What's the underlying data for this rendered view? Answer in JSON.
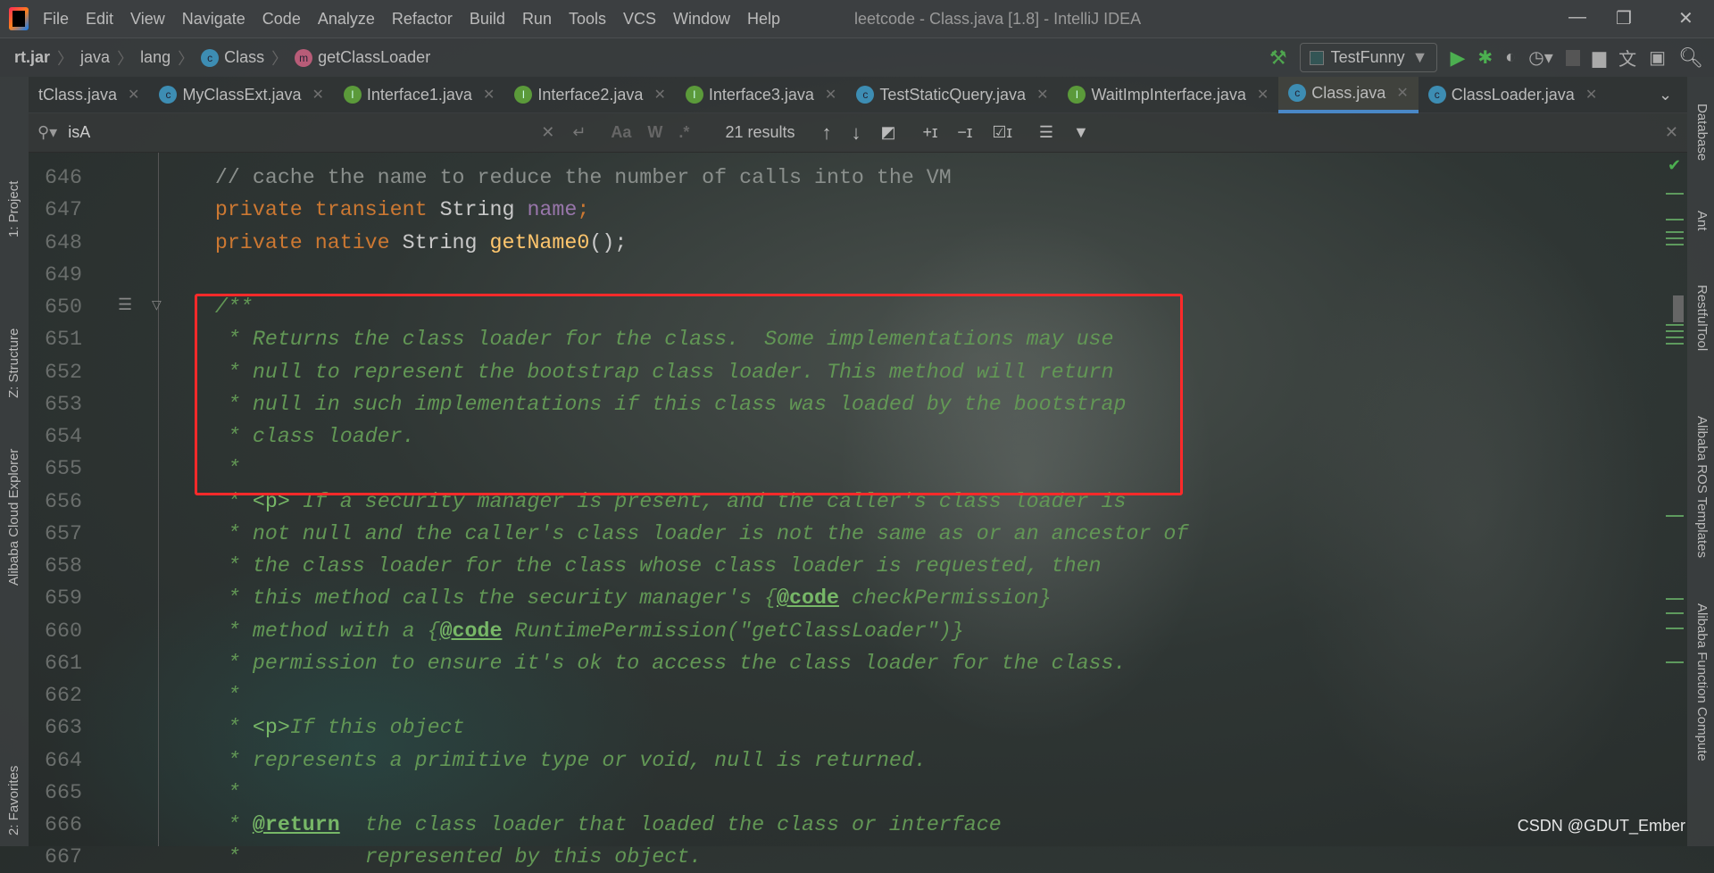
{
  "menu": [
    "File",
    "Edit",
    "View",
    "Navigate",
    "Code",
    "Analyze",
    "Refactor",
    "Build",
    "Run",
    "Tools",
    "VCS",
    "Window",
    "Help"
  ],
  "window_title": "leetcode - Class.java [1.8] - IntelliJ IDEA",
  "breadcrumb": [
    {
      "label": "rt.jar",
      "icon": ""
    },
    {
      "label": "java",
      "icon": ""
    },
    {
      "label": "lang",
      "icon": ""
    },
    {
      "label": "Class",
      "icon": "class-icon"
    },
    {
      "label": "getClassLoader",
      "icon": "method-icon"
    }
  ],
  "run_config": "TestFunny",
  "tabs": [
    {
      "label": "tClass.java",
      "icon": "",
      "active": false
    },
    {
      "label": "MyClassExt.java",
      "icon": "c",
      "active": false
    },
    {
      "label": "Interface1.java",
      "icon": "i",
      "active": false
    },
    {
      "label": "Interface2.java",
      "icon": "i",
      "active": false
    },
    {
      "label": "Interface3.java",
      "icon": "i",
      "active": false
    },
    {
      "label": "TestStaticQuery.java",
      "icon": "c",
      "active": false
    },
    {
      "label": "WaitImpInterface.java",
      "icon": "i",
      "active": false
    },
    {
      "label": "Class.java",
      "icon": "c",
      "active": true
    },
    {
      "label": "ClassLoader.java",
      "icon": "c",
      "active": false
    }
  ],
  "search": {
    "query": "isA",
    "match_case": "Aa",
    "words": "W",
    "regex": ".*",
    "results": "21 results"
  },
  "left_tools": [
    "1: Project",
    "Z: Structure",
    "Alibaba Cloud Explorer",
    "2: Favorites"
  ],
  "right_tools": [
    "Database",
    "Ant",
    "RestfulTool",
    "Alibaba ROS Templates",
    "Alibaba Function Compute"
  ],
  "code_lines": [
    {
      "n": "646",
      "s": [
        [
          "    ",
          ""
        ],
        [
          "// cache the name to reduce the number of calls into the VM",
          "cm"
        ]
      ]
    },
    {
      "n": "647",
      "s": [
        [
          "    ",
          ""
        ],
        [
          "private transient ",
          "kw"
        ],
        [
          "String ",
          "ty"
        ],
        [
          "name",
          "fd"
        ],
        [
          ";",
          "kw"
        ]
      ]
    },
    {
      "n": "648",
      "s": [
        [
          "    ",
          ""
        ],
        [
          "private native ",
          "kw"
        ],
        [
          "String ",
          "ty"
        ],
        [
          "getName0",
          "fn"
        ],
        [
          "();",
          "ty"
        ]
      ]
    },
    {
      "n": "649",
      "s": []
    },
    {
      "n": "650",
      "s": [
        [
          "    ",
          ""
        ],
        [
          "/**",
          "doc"
        ]
      ]
    },
    {
      "n": "651",
      "s": [
        [
          "     ",
          ""
        ],
        [
          "* Returns the class loader for the class.  Some implementations may use",
          "doc"
        ]
      ]
    },
    {
      "n": "652",
      "s": [
        [
          "     ",
          ""
        ],
        [
          "* null to represent the bootstrap class loader. This method will return",
          "doc"
        ]
      ]
    },
    {
      "n": "653",
      "s": [
        [
          "     ",
          ""
        ],
        [
          "* null in such implementations if this class was loaded by the bootstrap",
          "doc"
        ]
      ]
    },
    {
      "n": "654",
      "s": [
        [
          "     ",
          ""
        ],
        [
          "* class loader.",
          "doc"
        ]
      ]
    },
    {
      "n": "655",
      "s": [
        [
          "     ",
          ""
        ],
        [
          "*",
          "doc"
        ]
      ]
    },
    {
      "n": "656",
      "s": [
        [
          "     ",
          ""
        ],
        [
          "* ",
          "doc"
        ],
        [
          "<p>",
          "ht"
        ],
        [
          " If a security manager is present, and the caller's class loader is",
          "doc"
        ]
      ]
    },
    {
      "n": "657",
      "s": [
        [
          "     ",
          ""
        ],
        [
          "* not null and the caller's class loader is not the same as or an ancestor of",
          "doc"
        ]
      ]
    },
    {
      "n": "658",
      "s": [
        [
          "     ",
          ""
        ],
        [
          "* the class loader for the class whose class loader is requested, then",
          "doc"
        ]
      ]
    },
    {
      "n": "659",
      "s": [
        [
          "     ",
          ""
        ],
        [
          "* this method calls the security manager's {",
          "doc"
        ],
        [
          "@code",
          "tag"
        ],
        [
          " checkPermission}",
          "doc"
        ]
      ]
    },
    {
      "n": "660",
      "s": [
        [
          "     ",
          ""
        ],
        [
          "* method with a {",
          "doc"
        ],
        [
          "@code",
          "tag"
        ],
        [
          " RuntimePermission(\"getClassLoader\")}",
          "doc"
        ]
      ]
    },
    {
      "n": "661",
      "s": [
        [
          "     ",
          ""
        ],
        [
          "* permission to ensure it's ok to access the class loader for the class.",
          "doc"
        ]
      ]
    },
    {
      "n": "662",
      "s": [
        [
          "     ",
          ""
        ],
        [
          "*",
          "doc"
        ]
      ]
    },
    {
      "n": "663",
      "s": [
        [
          "     ",
          ""
        ],
        [
          "* ",
          "doc"
        ],
        [
          "<p>",
          "ht"
        ],
        [
          "If this object",
          "doc"
        ]
      ]
    },
    {
      "n": "664",
      "s": [
        [
          "     ",
          ""
        ],
        [
          "* represents a primitive type or void, null is returned.",
          "doc"
        ]
      ]
    },
    {
      "n": "665",
      "s": [
        [
          "     ",
          ""
        ],
        [
          "*",
          "doc"
        ]
      ]
    },
    {
      "n": "666",
      "s": [
        [
          "     ",
          ""
        ],
        [
          "* ",
          "doc"
        ],
        [
          "@return",
          "tag"
        ],
        [
          "  the class loader that loaded the class or interface",
          "doc"
        ]
      ]
    },
    {
      "n": "667",
      "s": [
        [
          "     ",
          ""
        ],
        [
          "*          represented by this object.",
          "doc"
        ]
      ]
    }
  ],
  "watermark": "CSDN @GDUT_Ember",
  "colors": {
    "keyword": "#cc7832",
    "doc_comment": "#629755",
    "highlight_box": "#ff2a2a",
    "active_tab": "#4a88c7"
  }
}
